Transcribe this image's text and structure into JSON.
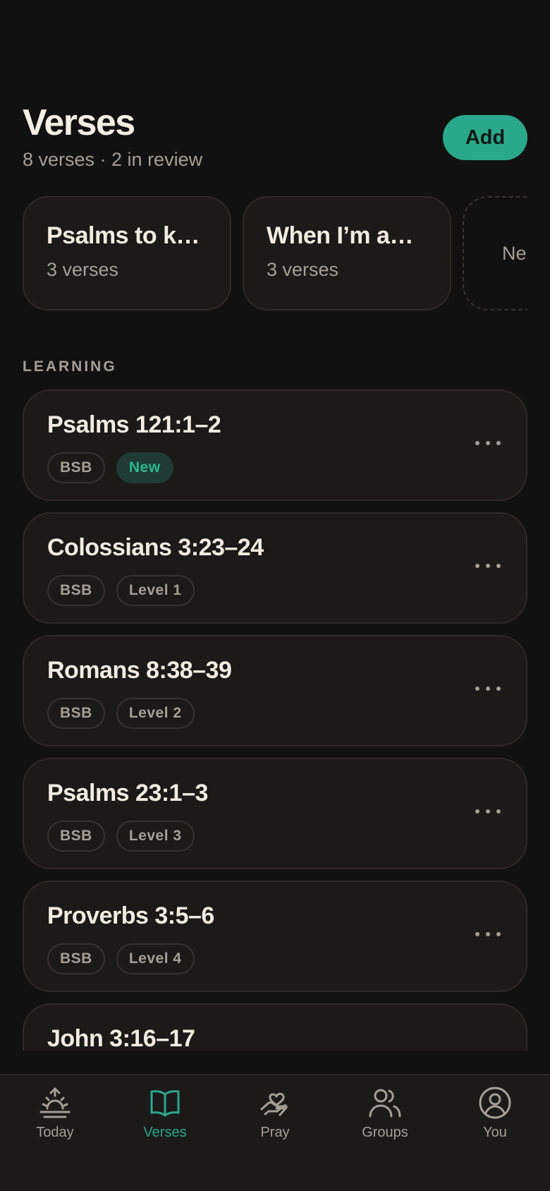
{
  "header": {
    "title": "Verses",
    "subtitle": "8 verses · 2 in review",
    "add_label": "Add"
  },
  "collections": [
    {
      "title": "Psalms to ke…",
      "count": "3 verses"
    },
    {
      "title": "When I’m an…",
      "count": "3 verses"
    }
  ],
  "new_collection_label": "Ne",
  "section_label": "LEARNING",
  "verses": [
    {
      "reference": "Psalms 121:1–2",
      "translation": "BSB",
      "status": "New"
    },
    {
      "reference": "Colossians 3:23–24",
      "translation": "BSB",
      "status": "Level 1"
    },
    {
      "reference": "Romans 8:38–39",
      "translation": "BSB",
      "status": "Level 2"
    },
    {
      "reference": "Psalms 23:1–3",
      "translation": "BSB",
      "status": "Level 3"
    },
    {
      "reference": "Proverbs 3:5–6",
      "translation": "BSB",
      "status": "Level 4"
    },
    {
      "reference": "John 3:16–17"
    }
  ],
  "tabs": [
    {
      "label": "Today",
      "icon": "sunrise-icon"
    },
    {
      "label": "Verses",
      "icon": "open-book-icon",
      "active": true
    },
    {
      "label": "Pray",
      "icon": "praying-hands-icon"
    },
    {
      "label": "Groups",
      "icon": "users-icon"
    },
    {
      "label": "You",
      "icon": "user-circle-icon"
    }
  ],
  "colors": {
    "accent": "#2aa88a",
    "background": "#121111",
    "card": "#1c1919",
    "muted_text": "#a59f97"
  }
}
